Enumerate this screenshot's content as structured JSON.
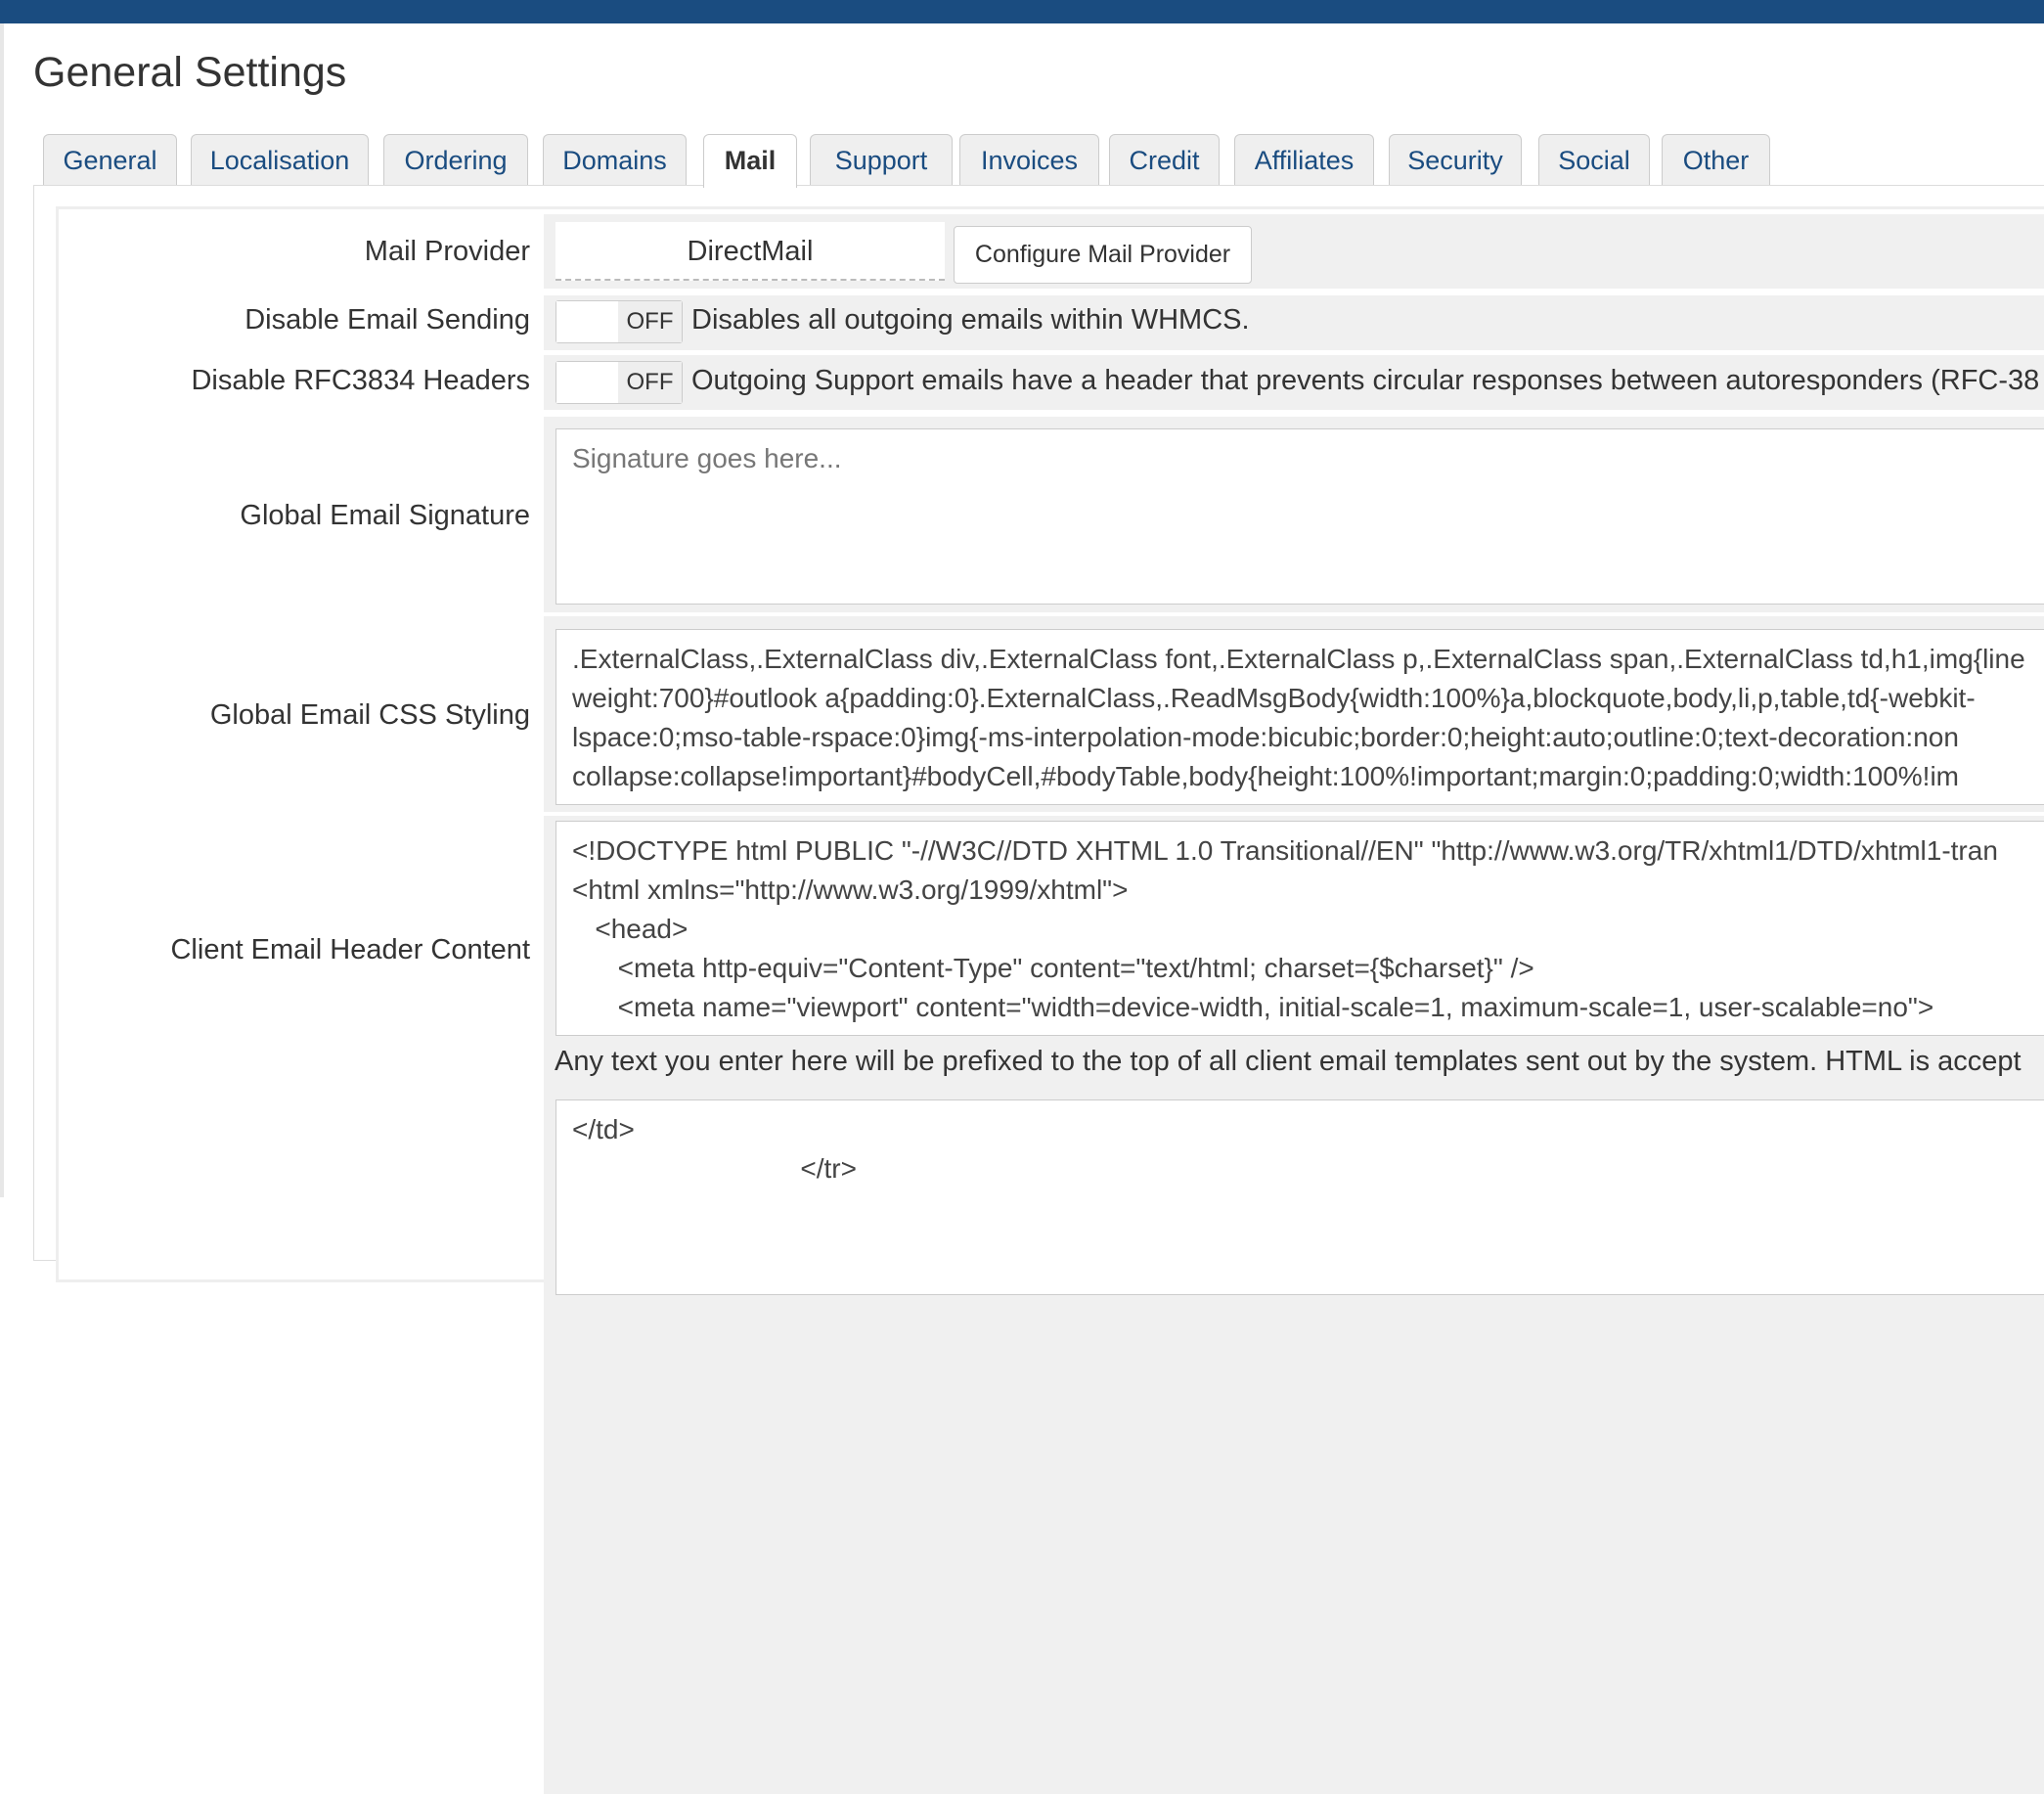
{
  "page": {
    "title": "General Settings"
  },
  "tabs": [
    "General",
    "Localisation",
    "Ordering",
    "Domains",
    "Mail",
    "Support",
    "Invoices",
    "Credit",
    "Affiliates",
    "Security",
    "Social",
    "Other"
  ],
  "active_tab": "Mail",
  "mail_provider": {
    "label": "Mail Provider",
    "value": "DirectMail",
    "button": "Configure Mail Provider"
  },
  "disable_email_sending": {
    "label": "Disable Email Sending",
    "state": "OFF",
    "description": "Disables all outgoing emails within WHMCS."
  },
  "disable_rfc_headers": {
    "label": "Disable RFC3834 Headers",
    "state": "OFF",
    "description": "Outgoing Support emails have a header that prevents circular responses between autoresponders (RFC-38"
  },
  "signature": {
    "label": "Global Email Signature",
    "placeholder": "Signature goes here..."
  },
  "css_styling": {
    "label": "Global Email CSS Styling",
    "value": ".ExternalClass,.ExternalClass div,.ExternalClass font,.ExternalClass p,.ExternalClass span,.ExternalClass td,h1,img{line\nweight:700}#outlook a{padding:0}.ExternalClass,.ReadMsgBody{width:100%}a,blockquote,body,li,p,table,td{-webkit-\nlspace:0;mso-table-rspace:0}img{-ms-interpolation-mode:bicubic;border:0;height:auto;outline:0;text-decoration:non\ncollapse:collapse!important}#bodyCell,#bodyTable,body{height:100%!important;margin:0;padding:0;width:100%!im"
  },
  "header_content": {
    "label": "Client Email Header Content",
    "value": "<!DOCTYPE html PUBLIC \"-//W3C//DTD XHTML 1.0 Transitional//EN\" \"http://www.w3.org/TR/xhtml1/DTD/xhtml1-tran\n<html xmlns=\"http://www.w3.org/1999/xhtml\">\n   <head>\n      <meta http-equiv=\"Content-Type\" content=\"text/html; charset={$charset}\" />\n      <meta name=\"viewport\" content=\"width=device-width, initial-scale=1, maximum-scale=1, user-scalable=no\">",
    "note": "Any text you enter here will be prefixed to the top of all client email templates sent out by the system. HTML is accept"
  },
  "footer_content": {
    "value": "</td>\n                              </tr>"
  }
}
